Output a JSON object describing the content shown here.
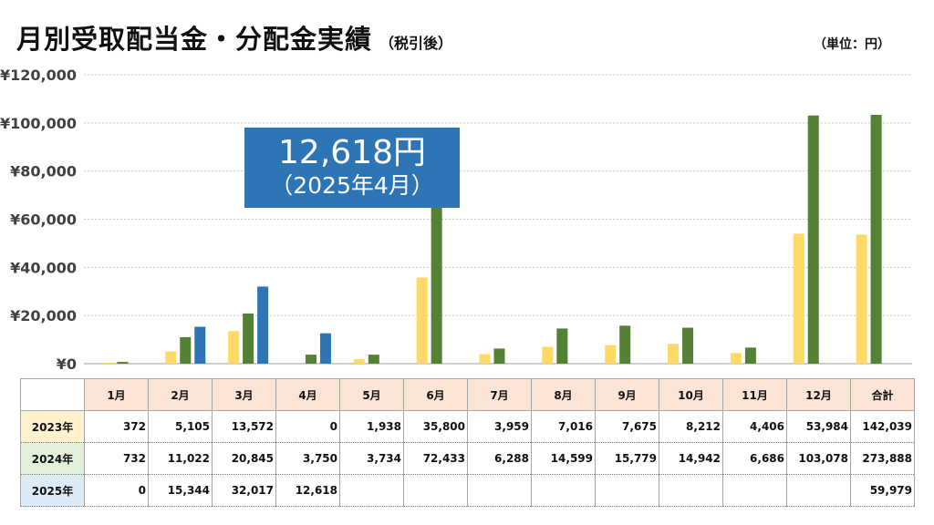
{
  "header": {
    "title": "月別受取配当金・分配金実績",
    "subtitle": "（税引後）",
    "unit": "（単位：円）"
  },
  "callout": {
    "amount": "12,618円",
    "period": "（2025年4月）"
  },
  "colors": {
    "y2023": "#ffd966",
    "y2024": "#548235",
    "y2025": "#2e75b6"
  },
  "chart_data": {
    "type": "bar",
    "categories": [
      "1月",
      "2月",
      "3月",
      "4月",
      "5月",
      "6月",
      "7月",
      "8月",
      "9月",
      "10月",
      "11月",
      "12月",
      "合計"
    ],
    "y_ticks": [
      "¥0",
      "¥20,000",
      "¥40,000",
      "¥60,000",
      "¥80,000",
      "¥100,000",
      "¥120,000"
    ],
    "ylim": [
      0,
      120000
    ],
    "grid": true,
    "series": [
      {
        "name": "2023年",
        "values": [
          372,
          5105,
          13572,
          0,
          1938,
          35800,
          3959,
          7016,
          7675,
          8212,
          4406,
          53984,
          142039
        ]
      },
      {
        "name": "2024年",
        "values": [
          732,
          11022,
          20845,
          3750,
          3734,
          72433,
          6288,
          14599,
          15779,
          14942,
          6686,
          103078,
          273888
        ]
      },
      {
        "name": "2025年",
        "values": [
          0,
          15344,
          32017,
          12618,
          null,
          null,
          null,
          null,
          null,
          null,
          null,
          null,
          59979
        ]
      }
    ],
    "plotted_series": [
      {
        "name": "2023年",
        "values": [
          372,
          5105,
          13572,
          0,
          1938,
          35800,
          3959,
          7016,
          7675,
          8212,
          4406,
          53984
        ]
      },
      {
        "name": "2024年",
        "values": [
          732,
          11022,
          20845,
          3750,
          3734,
          72433,
          6288,
          14599,
          15779,
          14942,
          6686,
          103078
        ]
      },
      {
        "name": "2025年",
        "values": [
          0,
          15344,
          32017,
          12618,
          null,
          null,
          null,
          null,
          null,
          null,
          null,
          null
        ]
      }
    ]
  },
  "table": {
    "headers": [
      "1月",
      "2月",
      "3月",
      "4月",
      "5月",
      "6月",
      "7月",
      "8月",
      "9月",
      "10月",
      "11月",
      "12月",
      "合計"
    ],
    "rows": [
      {
        "label": "2023年",
        "cells": [
          "372",
          "5,105",
          "13,572",
          "0",
          "1,938",
          "35,800",
          "3,959",
          "7,016",
          "7,675",
          "8,212",
          "4,406",
          "53,984",
          "142,039"
        ]
      },
      {
        "label": "2024年",
        "cells": [
          "732",
          "11,022",
          "20,845",
          "3,750",
          "3,734",
          "72,433",
          "6,288",
          "14,599",
          "15,779",
          "14,942",
          "6,686",
          "103,078",
          "273,888"
        ]
      },
      {
        "label": "2025年",
        "cells": [
          "0",
          "15,344",
          "32,017",
          "12,618",
          "",
          "",
          "",
          "",
          "",
          "",
          "",
          "",
          "59,979"
        ]
      }
    ]
  }
}
